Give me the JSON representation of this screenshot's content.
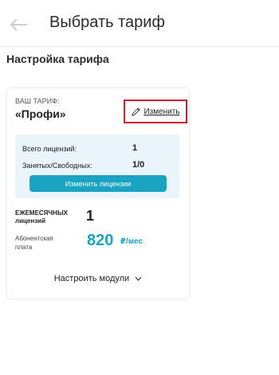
{
  "header": {
    "title": "Выбрать тариф"
  },
  "section": {
    "title": "Настройка тарифа"
  },
  "card": {
    "tariff_caption": "ВАШ ТАРИФ:",
    "tariff_name": "«Профи»",
    "edit_label": "Изменить",
    "licenses": {
      "total_label": "Всего лицензий:",
      "total_value": "1",
      "busy_label": "Занятых/Свободных:",
      "busy_value": "1/0",
      "button_label": "Изменить лицензии"
    },
    "monthly_label": "ЕЖЕМЕСЯЧНЫХ лицензий",
    "monthly_count": "1",
    "fee_label": "Абонентская плата",
    "fee_amount": "820",
    "fee_unit": "₽/мес",
    "modules_label": "Настроить модули"
  },
  "colors": {
    "accent": "#1aa4c2",
    "highlight_border": "#d41f2a",
    "license_box_bg": "#e9f4fb"
  },
  "icons": [
    "back-arrow-icon",
    "pencil-icon",
    "chevron-down-icon"
  ]
}
